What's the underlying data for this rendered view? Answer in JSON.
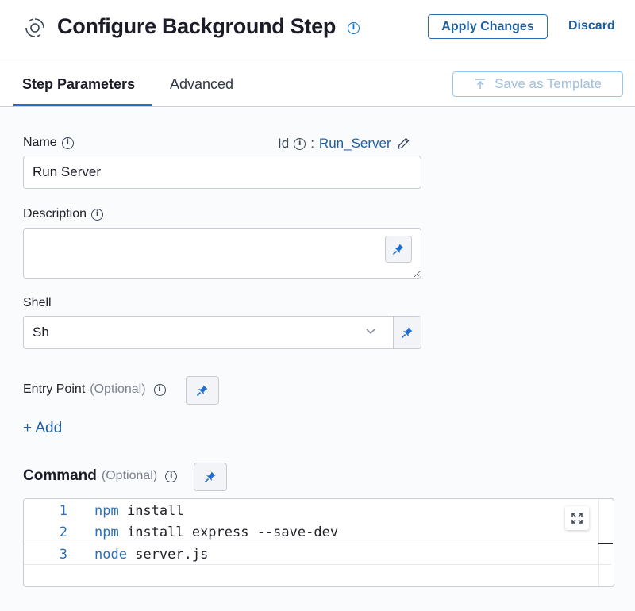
{
  "header": {
    "title": "Configure Background Step",
    "apply_label": "Apply Changes",
    "discard_label": "Discard"
  },
  "tabs": [
    {
      "label": "Step Parameters",
      "active": true
    },
    {
      "label": "Advanced",
      "active": false
    }
  ],
  "toolbar": {
    "save_template_label": "Save as Template"
  },
  "form": {
    "name_label": "Name",
    "name_value": "Run Server",
    "id_label": "Id",
    "id_separator": ":",
    "id_value": "Run_Server",
    "description_label": "Description",
    "description_value": "",
    "shell_label": "Shell",
    "shell_value": "Sh",
    "entry_point_label": "Entry Point",
    "entry_point_optional": "(Optional)",
    "add_label": "+ Add",
    "command_label": "Command",
    "command_optional": "(Optional)"
  },
  "editor": {
    "lines": [
      {
        "number": "1",
        "keyword": "npm",
        "rest": " install"
      },
      {
        "number": "2",
        "keyword": "npm",
        "rest": " install express --save-dev"
      },
      {
        "number": "3",
        "keyword": "node",
        "rest": " server.js"
      }
    ]
  },
  "colors": {
    "accent": "#1f5f9f",
    "tab_underline": "#1f6fd0",
    "border": "#c9ccd3"
  }
}
